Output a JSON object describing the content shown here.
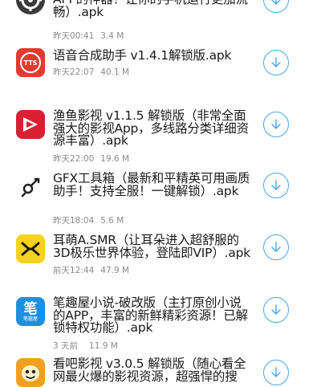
{
  "apps": [
    {
      "title": "APP的神器！让你的手机运行更加流畅）.apk",
      "time": "昨天00:41",
      "size": "3.4 M",
      "icon": "settings-gear-icon",
      "icon_bg": "#3a3a3a"
    },
    {
      "title": "语音合成助手 v1.4.1解锁版.apk",
      "time": "昨天22:07",
      "size": "40.1 M",
      "icon": "tts-icon",
      "icon_label": "TTS",
      "icon_bg": "#e23c2f"
    },
    {
      "title": "渔鱼影视 v1.1.5 解锁版（非常全面强大的影视App，多线路分类详细资源丰富）.apk",
      "time": "昨天22:00",
      "size": "19.6 M",
      "icon": "video-play-icon",
      "icon_bg": "#d92033"
    },
    {
      "title": "GFX工具箱（最新和平精英可用画质助手！支持全服！一键解锁）.apk",
      "time": "昨天18:04",
      "size": "5.6 M",
      "icon": "gear-tools-icon",
      "icon_bg": "#ffffff"
    },
    {
      "title": "耳萌A.SMR（让耳朵进入超舒服的3D极乐世界体验，登陆即VIP）.apk",
      "time": "前天12:44",
      "size": "47.9 M",
      "icon": "asmr-logo-icon",
      "icon_bg": "#f6d21c"
    },
    {
      "title": "笔趣屋小说-破改版（主打原创小说的APP，丰富的新鲜精彩资源！已解锁特权功能）.apk",
      "time": "3 天前",
      "size": "11.9 M",
      "icon": "book-brush-icon",
      "icon_label": "笔",
      "icon_sublabel": "笔趣屋",
      "icon_bg": "#1e8fe0"
    },
    {
      "title": "看吧影视 v3.0.5 解锁版（随心看全网最火爆的影视资源，超强悍的搜",
      "time": "",
      "size": "",
      "icon": "cartoon-face-icon",
      "icon_bg": "#f0a020"
    }
  ],
  "download_icon": "download-arrow-icon",
  "accent_color": "#4aa6ec"
}
